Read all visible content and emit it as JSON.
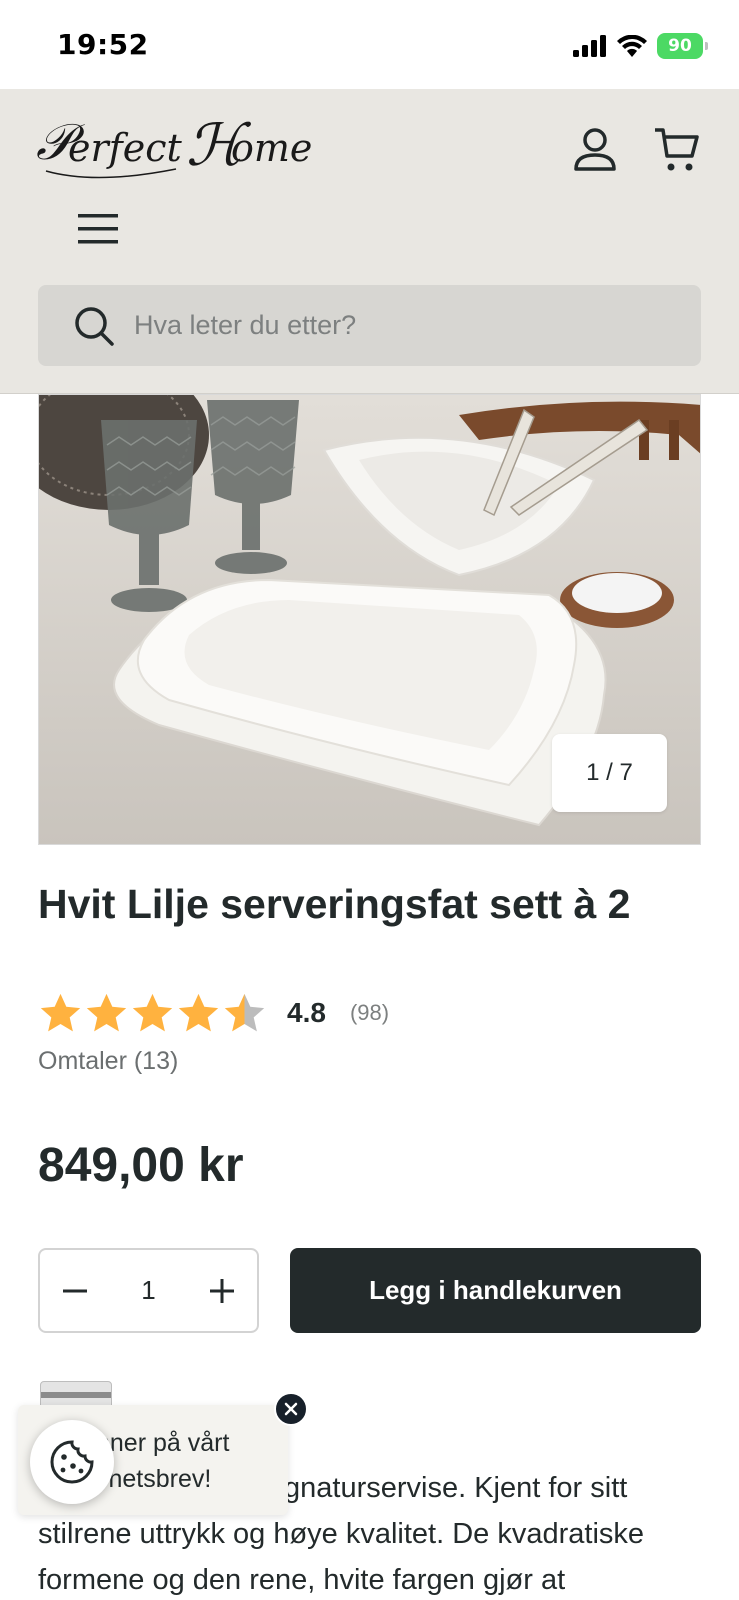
{
  "status_bar": {
    "time": "19:52",
    "battery": "90"
  },
  "header": {
    "logo_text": "Perfect Home",
    "search_placeholder": "Hva leter du etter?",
    "background_color": "#e9e7e2"
  },
  "gallery": {
    "counter": "1 / 7",
    "current": 1,
    "total": 7
  },
  "product": {
    "title": "Hvit Lilje serveringsfat sett à 2",
    "rating": "4.8",
    "rating_value": 4.8,
    "rating_max": 5,
    "rating_count": "(98)",
    "reviews_link": "Omtaler (13)",
    "price": "849,00 kr",
    "quantity": "1",
    "add_to_cart_label": "Legg i handlekurven",
    "description_line1_visible": "gnaturservise. Kjent for sitt",
    "description_line2": "stilrene uttrykk og høye kvalitet. De kvadratiske",
    "description_line3": "formene og den rene, hvite fargen gjør at"
  },
  "newsletter_popup": {
    "text_line1": "nner på vårt",
    "text_line2": "yhetsbrev!"
  },
  "colors": {
    "primary": "#232a2b",
    "star": "#ffb23f",
    "star_empty": "#bcbcbc",
    "battery": "#4cd964"
  },
  "icons": {
    "account": "user-icon",
    "cart": "cart-icon",
    "menu": "hamburger-icon",
    "search": "search-icon",
    "cookie": "cookie-icon",
    "close": "close-icon"
  }
}
